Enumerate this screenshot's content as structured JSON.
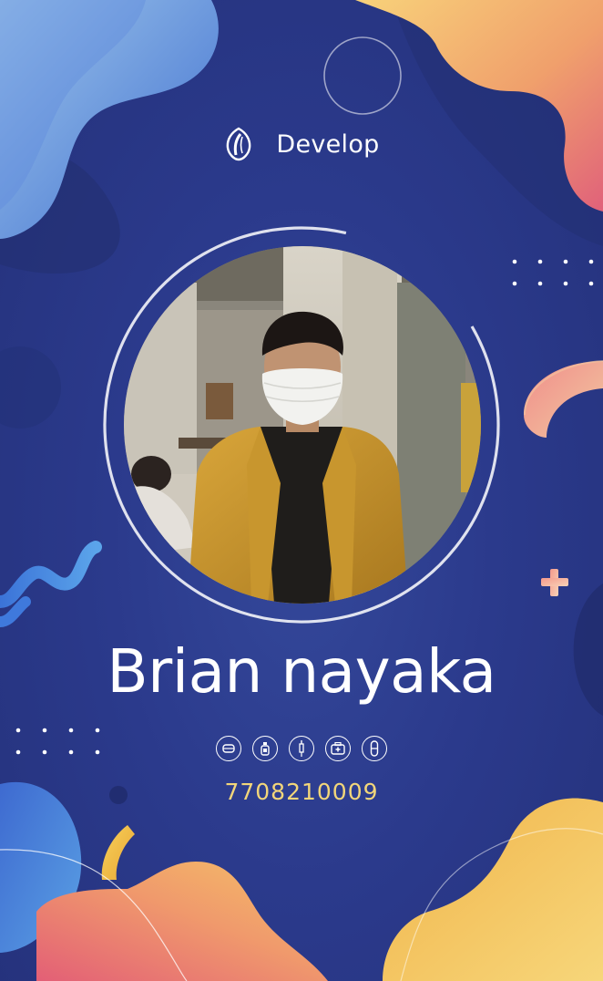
{
  "brand": {
    "label": "Develop",
    "logo_icon": "leaf-swirl-icon"
  },
  "profile": {
    "name": "Brian nayaka",
    "phone": "7708210009",
    "photo": "masked-person-portrait"
  },
  "badges": [
    "face-mask-icon",
    "sanitizer-bottle-icon",
    "syringe-icon",
    "first-aid-kit-icon",
    "capsule-pill-icon"
  ],
  "colors": {
    "background": "#2b3a8c",
    "blob_blue": "#4a7fd6",
    "blob_orange": "#f0a46a",
    "blob_pink": "#e4677a",
    "blob_yellow": "#f3c24f",
    "phone_text": "#f2d67a"
  }
}
